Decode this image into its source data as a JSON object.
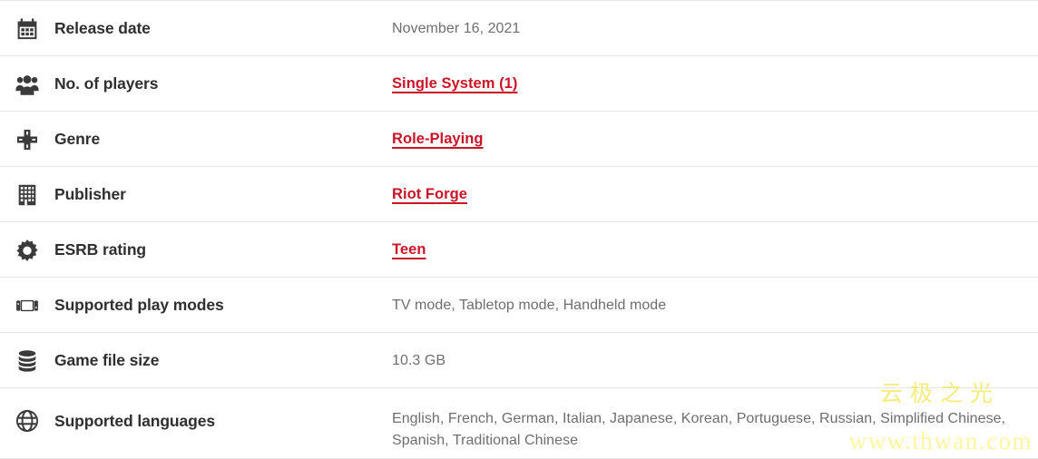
{
  "table": {
    "rows": [
      {
        "icon": "calendar-icon",
        "label": "Release date",
        "value": "November 16, 2021",
        "is_link": false,
        "tall": false
      },
      {
        "icon": "players-group-icon",
        "label": "No. of players",
        "value": "Single System (1)",
        "is_link": true,
        "tall": false
      },
      {
        "icon": "dpad-icon",
        "label": "Genre",
        "value": "Role-Playing",
        "is_link": true,
        "tall": false
      },
      {
        "icon": "building-icon",
        "label": "Publisher",
        "value": "Riot Forge",
        "is_link": true,
        "tall": false
      },
      {
        "icon": "gear-icon",
        "label": "ESRB rating",
        "value": "Teen",
        "is_link": true,
        "tall": false
      },
      {
        "icon": "switch-console-icon",
        "label": "Supported play modes",
        "value": "TV mode, Tabletop mode, Handheld mode",
        "is_link": false,
        "tall": false
      },
      {
        "icon": "database-icon",
        "label": "Game file size",
        "value": "10.3 GB",
        "is_link": false,
        "tall": false
      },
      {
        "icon": "globe-icon",
        "label": "Supported languages",
        "value": "English, French, German, Italian, Japanese, Korean, Portuguese, Russian, Simplified Chinese, Spanish, Traditional Chinese",
        "is_link": false,
        "tall": true
      }
    ]
  },
  "watermark": {
    "cjk": "云极之光",
    "url": "www.thwan.com"
  },
  "colors": {
    "link": "#cc1429",
    "label": "#2f2f2f",
    "value": "#6e6e6e",
    "divider": "#e6e6e6",
    "icon": "#3b3b3b",
    "watermark": "#fdf6a0"
  }
}
